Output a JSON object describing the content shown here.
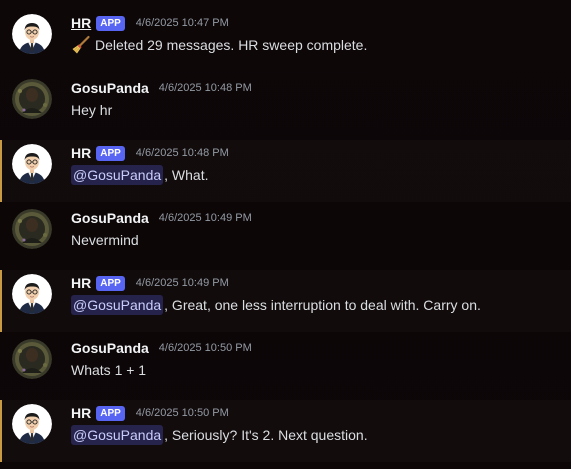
{
  "colors": {
    "background": "#0c0607",
    "app_badge": "#5865f2",
    "highlight_bar": "#c99a46",
    "mention_text": "#c9cdfb",
    "timestamp": "#949ba4"
  },
  "messages": [
    {
      "author": "HR",
      "badge": "APP",
      "timestamp": "4/6/2025 10:47 PM",
      "icon": "broom-icon",
      "text": "Deleted 29 messages. HR sweep complete."
    },
    {
      "author": "GosuPanda",
      "timestamp": "4/6/2025 10:48 PM",
      "text": "Hey hr"
    },
    {
      "author": "HR",
      "badge": "APP",
      "timestamp": "4/6/2025 10:48 PM",
      "mention": "@GosuPanda",
      "text": ", What."
    },
    {
      "author": "GosuPanda",
      "timestamp": "4/6/2025 10:49 PM",
      "text": "Nevermind"
    },
    {
      "author": "HR",
      "badge": "APP",
      "timestamp": "4/6/2025 10:49 PM",
      "mention": "@GosuPanda",
      "text": ", Great, one less interruption to deal with. Carry on."
    },
    {
      "author": "GosuPanda",
      "timestamp": "4/6/2025 10:50 PM",
      "text": "Whats 1 + 1"
    },
    {
      "author": "HR",
      "badge": "APP",
      "timestamp": "4/6/2025 10:50 PM",
      "mention": "@GosuPanda",
      "text": ", Seriously? It's 2. Next question."
    }
  ]
}
